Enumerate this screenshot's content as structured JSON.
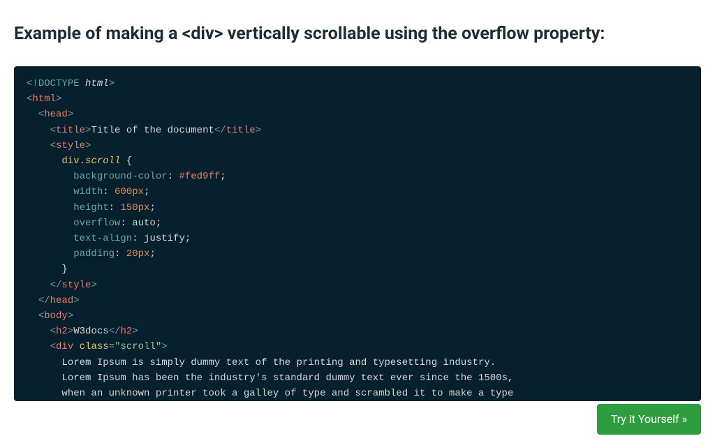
{
  "title": "Example of making a <div> vertically scrollable using the overflow property:",
  "try_btn": "Try it Yourself »",
  "code": {
    "doctype_open": "<!",
    "doctype_word": "DOCTYPE",
    "doctype_html": "html",
    "doctype_close": ">",
    "html_open_l": "<",
    "html_tag": "html",
    "html_open_r": ">",
    "head_open_l": "<",
    "head_tag": "head",
    "head_open_r": ">",
    "title_open_l": "<",
    "title_tag": "title",
    "title_open_r": ">",
    "title_text": "Title of the document",
    "title_close_l": "</",
    "title_close_r": ">",
    "style_open_l": "<",
    "style_tag": "style",
    "style_open_r": ">",
    "sel_tag": "div",
    "sel_dot": ".",
    "sel_class": "scroll",
    "brace_open": " {",
    "p1_name": "background-color",
    "p1_colon": ": ",
    "p1_val": "#fed9ff",
    "semi": ";",
    "p2_name": "width",
    "p2_val": "600px",
    "p3_name": "height",
    "p3_val": "150px",
    "p4_name": "overflow",
    "p4_val": "auto",
    "p5_name": "text-align",
    "p5_val": "justify",
    "p6_name": "padding",
    "p6_val": "20px",
    "brace_close": "}",
    "style_close_l": "</",
    "style_close_r": ">",
    "head_close_l": "</",
    "head_close_r": ">",
    "body_open_l": "<",
    "body_tag": "body",
    "body_open_r": ">",
    "h2_open_l": "<",
    "h2_tag": "h2",
    "h2_open_r": ">",
    "h2_text": "W3docs",
    "h2_close_l": "</",
    "h2_close_r": ">",
    "div_open_l": "<",
    "div_tag": "div",
    "div_attr_name": "class",
    "div_attr_eq": "=",
    "div_attr_q": "\"",
    "div_attr_val": "scroll",
    "div_open_r": ">",
    "lorem1": "Lorem Ipsum is simply dummy text of the printing and typesetting industry.",
    "lorem2": "Lorem Ipsum has been the industry's standard dummy text ever since the 1500s,",
    "lorem3": "when an unknown printer took a galley of type and scrambled it to make a type"
  }
}
